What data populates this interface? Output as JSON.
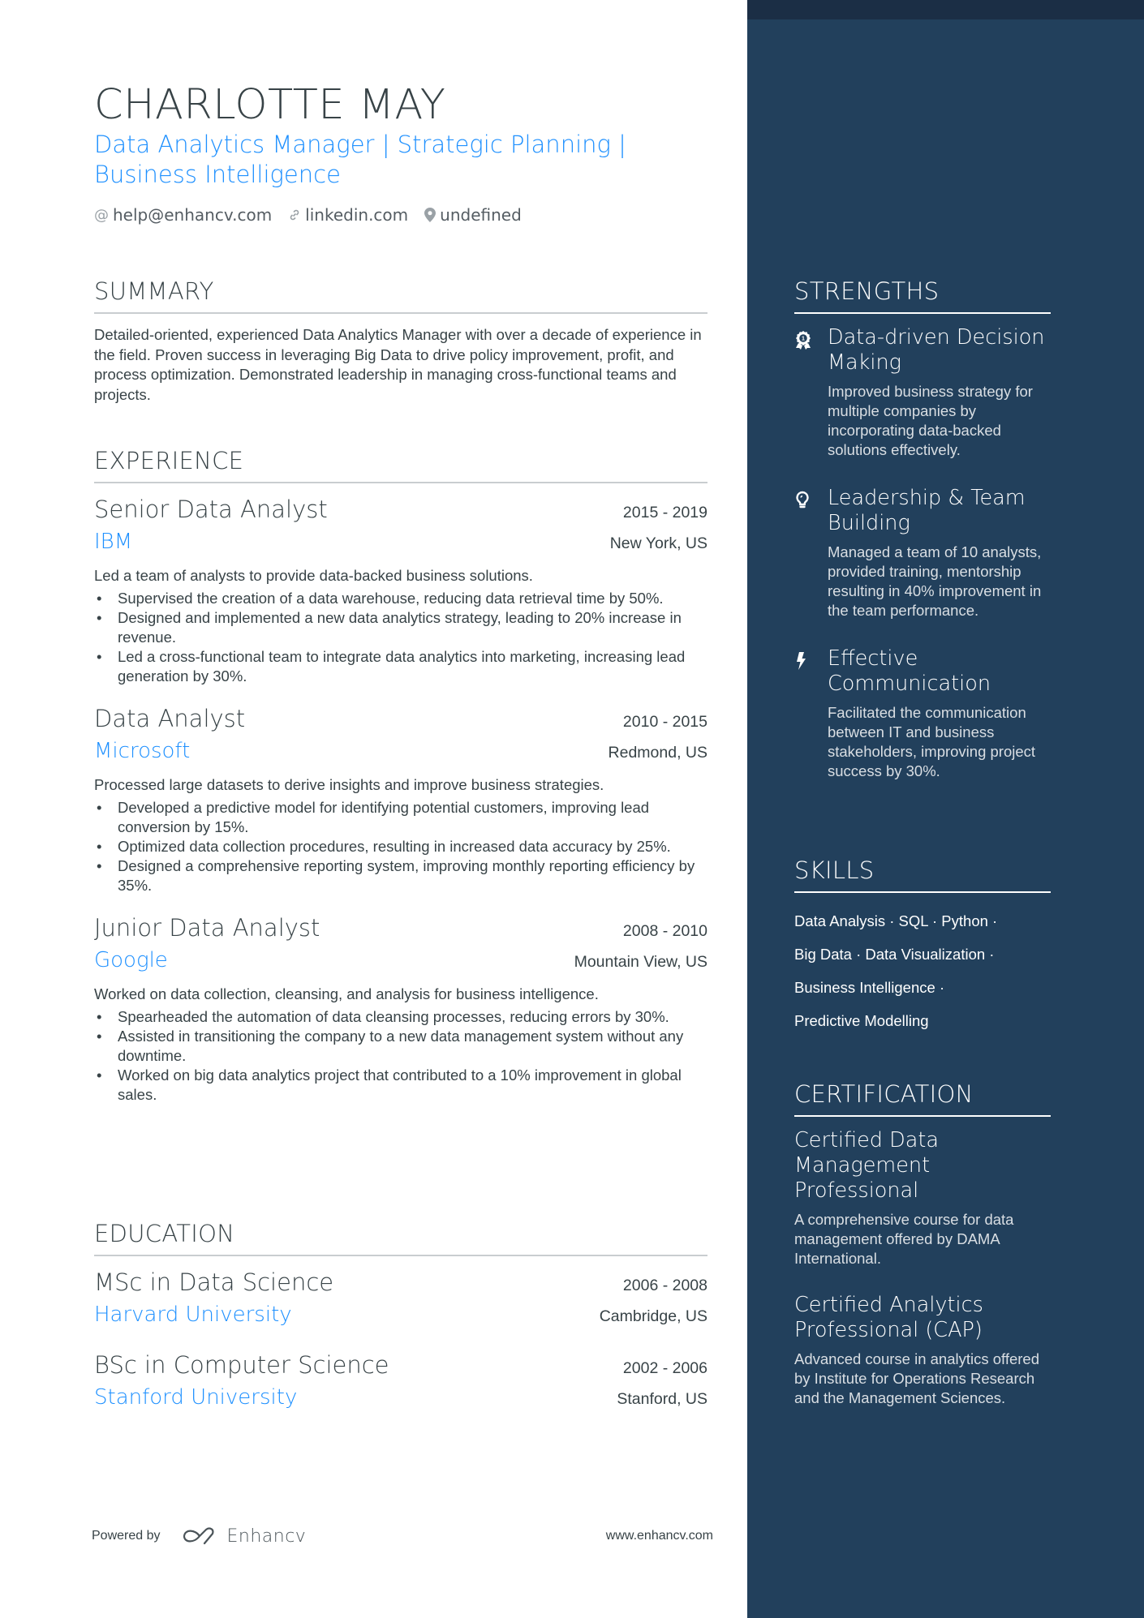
{
  "header": {
    "name": "CHARLOTTE MAY",
    "subtitle_line1": "Data Analytics Manager | Strategic Planning |",
    "subtitle_line2": "Business Intelligence",
    "contacts": [
      {
        "icon": "at-icon",
        "text": "help@enhancv.com"
      },
      {
        "icon": "link-icon",
        "text": "linkedin.com"
      },
      {
        "icon": "location-pin-icon",
        "text": "undefined"
      }
    ]
  },
  "summary": {
    "title": "SUMMARY",
    "text": "Detailed-oriented, experienced Data Analytics Manager with over a decade of experience in the field. Proven success in leveraging Big Data to drive policy improvement, profit, and process optimization. Demonstrated leadership in managing cross-functional teams and projects."
  },
  "experience": {
    "title": "EXPERIENCE",
    "jobs": [
      {
        "title": "Senior Data Analyst",
        "dates": "2015 - 2019",
        "company": "IBM",
        "location": "New York, US",
        "description": "Led a team of analysts to provide data-backed business solutions.",
        "bullets": [
          "Supervised the creation of a data warehouse, reducing data retrieval time by 50%.",
          "Designed and implemented a new data analytics strategy, leading to 20% increase in revenue.",
          "Led a cross-functional team to integrate data analytics into marketing, increasing lead generation by 30%."
        ]
      },
      {
        "title": "Data Analyst",
        "dates": "2010 - 2015",
        "company": "Microsoft",
        "location": "Redmond, US",
        "description": "Processed large datasets to derive insights and improve business strategies.",
        "bullets": [
          "Developed a predictive model for identifying potential customers, improving lead conversion by 15%.",
          "Optimized data collection procedures, resulting in increased data accuracy by 25%.",
          "Designed a comprehensive reporting system, improving monthly reporting efficiency by 35%."
        ]
      },
      {
        "title": "Junior Data Analyst",
        "dates": "2008 - 2010",
        "company": "Google",
        "location": "Mountain View, US",
        "description": "Worked on data collection, cleansing, and analysis for business intelligence.",
        "bullets": [
          "Spearheaded the automation of data cleansing processes, reducing errors by 30%.",
          "Assisted in transitioning the company to a new data management system without any downtime.",
          "Worked on big data analytics project that contributed to a 10% improvement in global sales."
        ]
      }
    ]
  },
  "education": {
    "title": "EDUCATION",
    "items": [
      {
        "degree": "MSc in Data Science",
        "dates": "2006 - 2008",
        "school": "Harvard University",
        "location": "Cambridge, US"
      },
      {
        "degree": "BSc in Computer Science",
        "dates": "2002 - 2006",
        "school": "Stanford University",
        "location": "Stanford, US"
      }
    ]
  },
  "strengths": {
    "title": "STRENGTHS",
    "items": [
      {
        "icon": "award-ribbon-icon",
        "title": "Data-driven Decision Making",
        "description": "Improved business strategy for multiple companies by incorporating data-backed solutions effectively."
      },
      {
        "icon": "lightbulb-icon",
        "title": "Leadership & Team Building",
        "description": "Managed a team of 10 analysts, provided training, mentorship resulting in 40% improvement in the team performance."
      },
      {
        "icon": "lightning-bolt-icon",
        "title": "Effective Communication",
        "description": "Facilitated the communication between IT and business stakeholders, improving project success by 30%."
      }
    ]
  },
  "skills": {
    "title": "SKILLS",
    "lines": [
      "Data Analysis · SQL · Python ·",
      "Big Data · Data Visualization ·",
      "Business Intelligence ·",
      "Predictive Modelling"
    ]
  },
  "certification": {
    "title": "CERTIFICATION",
    "items": [
      {
        "title": "Certified Data Management Professional",
        "description": "A comprehensive course for data management offered by DAMA International."
      },
      {
        "title": "Certified Analytics Professional (CAP)",
        "description": "Advanced course in analytics offered by Institute for Operations Research and the Management Sciences."
      }
    ]
  },
  "footer": {
    "powered_by": "Powered by",
    "logo_text": "Enhancv",
    "website": "www.enhancv.com"
  },
  "colors": {
    "accent": "#1e90ff",
    "sidebar_bg": "#22405c",
    "sidebar_top": "#1b2e45",
    "text": "#384347"
  }
}
